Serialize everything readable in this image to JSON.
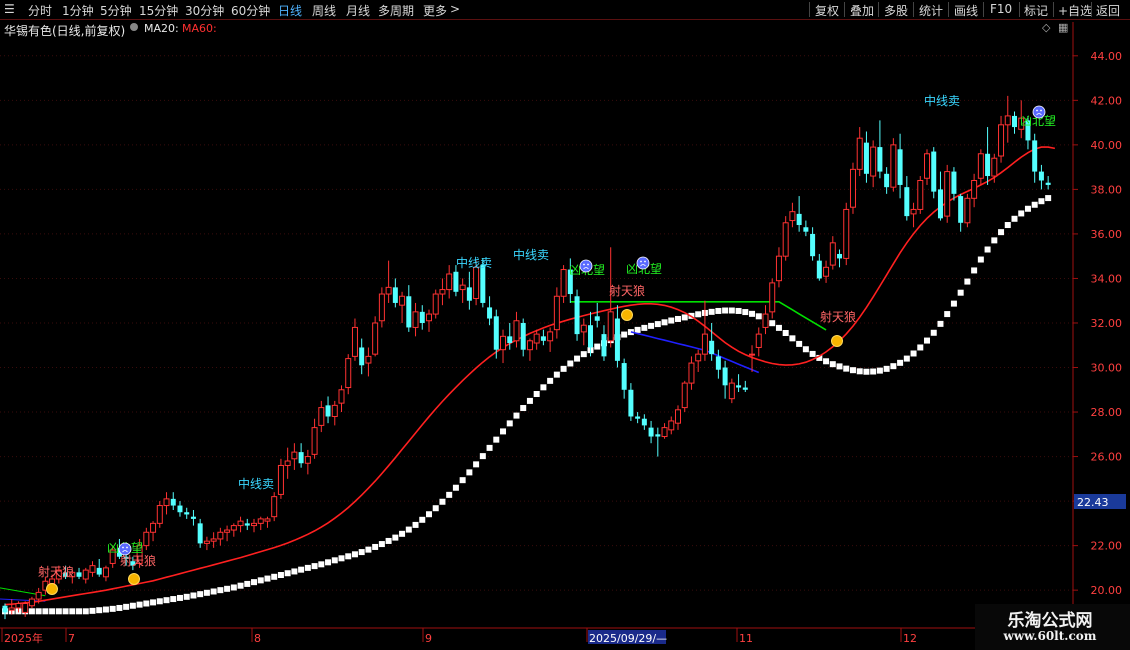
{
  "toolbar": {
    "periods": [
      "分时",
      "1分钟",
      "5分钟",
      "15分钟",
      "30分钟",
      "60分钟",
      "日线",
      "周线",
      "月线",
      "多周期",
      "更多"
    ],
    "active_period": "日线",
    "more_arrow": ">",
    "right_buttons": [
      "复权",
      "叠加",
      "多股",
      "统计",
      "画线",
      "F10",
      "标记",
      "+自选",
      "返回"
    ]
  },
  "info": {
    "title": "华锡有色(日线,前复权)",
    "ma20_label": "MA20:",
    "ma60_label": "MA60:"
  },
  "colors": {
    "up": "#ff3232",
    "down": "#54ffff",
    "ma20": "#ff2020",
    "white_line": "#ffffff",
    "green_line": "#00e000",
    "blue_line": "#2020ff",
    "axis": "#a01010",
    "label_price": "#ff4040",
    "last_price_bg": "#1a3a9a"
  },
  "icons": {
    "frown": "frown-face-icon",
    "coin": "gold-coin-icon",
    "diamond": "diamond-icon",
    "grid": "grid-icon",
    "menu": "menu-icon",
    "dropdown": "dropdown-icon"
  },
  "price_labels": [
    "44.00",
    "42.00",
    "40.00",
    "38.00",
    "36.00",
    "34.00",
    "32.00",
    "30.00",
    "28.00",
    "26.00",
    "24.00",
    "22.00",
    "20.00"
  ],
  "last_price": "22.43",
  "x_labels": [
    "2025年",
    "7",
    "8",
    "9",
    "2025/09/29/—",
    "11",
    "12"
  ],
  "brand": {
    "name": "乐淘公式网",
    "url": "www.60lt.com"
  },
  "chart_data": {
    "type": "candlestick",
    "title": "华锡有色(日线,前复权)",
    "ylim": [
      18.3,
      44.8
    ],
    "y_ticks": [
      20,
      22,
      24,
      26,
      28,
      30,
      32,
      34,
      36,
      38,
      40,
      42,
      44
    ],
    "x_tick_labels": [
      "2025年",
      "7",
      "8",
      "9",
      "2025/09/29/—",
      "11",
      "12"
    ],
    "ohlc": [
      [
        19.3,
        19.4,
        18.7,
        19.0
      ],
      [
        19.1,
        19.6,
        18.9,
        19.2
      ],
      [
        19.2,
        19.5,
        19.0,
        19.4
      ],
      [
        19.0,
        19.5,
        18.8,
        19.4
      ],
      [
        19.3,
        19.7,
        19.2,
        19.6
      ],
      [
        19.6,
        20.1,
        19.4,
        19.9
      ],
      [
        20.0,
        20.6,
        19.8,
        20.4
      ],
      [
        20.3,
        20.7,
        20.1,
        20.5
      ],
      [
        20.5,
        21.1,
        20.3,
        20.9
      ],
      [
        20.8,
        21.1,
        20.5,
        20.6
      ],
      [
        20.6,
        20.9,
        20.3,
        20.8
      ],
      [
        20.8,
        21.0,
        20.5,
        20.6
      ],
      [
        20.5,
        21.0,
        20.3,
        20.9
      ],
      [
        20.8,
        21.3,
        20.6,
        21.1
      ],
      [
        21.0,
        21.4,
        20.6,
        20.7
      ],
      [
        20.6,
        21.1,
        20.4,
        21.0
      ],
      [
        21.2,
        22.0,
        21.0,
        21.8
      ],
      [
        21.9,
        22.3,
        21.4,
        21.5
      ],
      [
        21.5,
        21.9,
        21.1,
        21.4
      ],
      [
        21.3,
        21.5,
        20.9,
        21.1
      ],
      [
        21.2,
        22.3,
        21.0,
        22.0
      ],
      [
        22.0,
        22.8,
        21.8,
        22.6
      ],
      [
        22.6,
        23.1,
        22.2,
        23.0
      ],
      [
        23.0,
        24.0,
        22.8,
        23.8
      ],
      [
        23.8,
        24.4,
        23.4,
        24.1
      ],
      [
        24.1,
        24.4,
        23.6,
        23.8
      ],
      [
        23.8,
        24.0,
        23.3,
        23.5
      ],
      [
        23.5,
        23.7,
        23.2,
        23.4
      ],
      [
        23.3,
        23.6,
        22.9,
        23.2
      ],
      [
        23.0,
        23.2,
        21.9,
        22.1
      ],
      [
        22.1,
        22.4,
        21.8,
        22.2
      ],
      [
        22.2,
        22.6,
        21.9,
        22.3
      ],
      [
        22.3,
        22.8,
        22.0,
        22.6
      ],
      [
        22.6,
        22.9,
        22.2,
        22.7
      ],
      [
        22.7,
        23.0,
        22.4,
        22.9
      ],
      [
        22.9,
        23.3,
        22.6,
        23.1
      ],
      [
        23.0,
        23.2,
        22.7,
        22.9
      ],
      [
        22.9,
        23.2,
        22.6,
        23.0
      ],
      [
        23.0,
        23.3,
        22.7,
        23.2
      ],
      [
        23.1,
        23.3,
        22.8,
        23.2
      ],
      [
        23.3,
        24.4,
        23.1,
        24.2
      ],
      [
        24.3,
        25.9,
        24.1,
        25.6
      ],
      [
        25.6,
        26.4,
        25.0,
        25.8
      ],
      [
        25.9,
        26.6,
        25.4,
        26.2
      ],
      [
        26.2,
        26.6,
        25.5,
        25.7
      ],
      [
        25.7,
        26.3,
        25.2,
        26.0
      ],
      [
        26.1,
        27.7,
        25.9,
        27.3
      ],
      [
        27.4,
        28.5,
        27.1,
        28.2
      ],
      [
        28.3,
        28.7,
        27.5,
        27.8
      ],
      [
        27.8,
        28.5,
        27.4,
        28.3
      ],
      [
        28.4,
        29.2,
        28.0,
        29.0
      ],
      [
        29.1,
        30.6,
        28.8,
        30.4
      ],
      [
        30.5,
        32.2,
        30.3,
        31.8
      ],
      [
        30.9,
        31.3,
        29.7,
        30.1
      ],
      [
        30.2,
        30.9,
        29.6,
        30.5
      ],
      [
        30.6,
        32.3,
        30.5,
        32.0
      ],
      [
        32.1,
        33.6,
        31.8,
        33.3
      ],
      [
        33.3,
        34.8,
        32.9,
        33.6
      ],
      [
        33.6,
        34.0,
        32.7,
        32.9
      ],
      [
        32.8,
        33.4,
        32.0,
        33.2
      ],
      [
        33.2,
        33.7,
        31.6,
        31.8
      ],
      [
        31.8,
        32.9,
        31.4,
        32.5
      ],
      [
        32.5,
        32.8,
        31.7,
        32.0
      ],
      [
        32.1,
        32.6,
        31.6,
        32.4
      ],
      [
        32.4,
        33.5,
        32.2,
        33.3
      ],
      [
        33.3,
        34.0,
        32.8,
        33.5
      ],
      [
        33.5,
        34.6,
        33.1,
        34.2
      ],
      [
        34.3,
        34.6,
        33.2,
        33.4
      ],
      [
        33.5,
        34.0,
        32.9,
        33.7
      ],
      [
        33.6,
        34.3,
        32.6,
        33.0
      ],
      [
        33.1,
        34.8,
        32.8,
        34.5
      ],
      [
        34.6,
        34.9,
        32.7,
        32.9
      ],
      [
        32.7,
        33.2,
        31.9,
        32.2
      ],
      [
        32.3,
        32.6,
        30.4,
        30.8
      ],
      [
        30.8,
        31.7,
        30.2,
        31.4
      ],
      [
        31.4,
        32.0,
        30.8,
        31.1
      ],
      [
        31.2,
        32.5,
        30.9,
        32.1
      ],
      [
        32.0,
        32.2,
        30.5,
        30.8
      ],
      [
        30.8,
        31.3,
        30.3,
        31.2
      ],
      [
        31.1,
        31.7,
        30.8,
        31.5
      ],
      [
        31.4,
        31.7,
        31.0,
        31.2
      ],
      [
        31.2,
        31.8,
        30.7,
        31.6
      ],
      [
        31.7,
        33.6,
        31.3,
        33.2
      ],
      [
        33.2,
        34.6,
        32.9,
        34.4
      ],
      [
        34.4,
        34.9,
        32.9,
        33.3
      ],
      [
        33.2,
        33.5,
        31.2,
        31.5
      ],
      [
        31.6,
        32.2,
        31.0,
        31.9
      ],
      [
        31.9,
        32.5,
        30.5,
        30.9
      ],
      [
        32.3,
        32.9,
        31.8,
        32.1
      ],
      [
        31.5,
        31.9,
        30.3,
        30.5
      ],
      [
        31.2,
        35.4,
        30.9,
        32.5
      ],
      [
        32.2,
        32.8,
        30.0,
        30.3
      ],
      [
        30.2,
        30.4,
        28.6,
        29.0
      ],
      [
        29.0,
        29.3,
        27.6,
        27.8
      ],
      [
        27.8,
        28.0,
        27.5,
        27.7
      ],
      [
        27.7,
        27.9,
        27.2,
        27.4
      ],
      [
        27.3,
        27.6,
        26.6,
        26.9
      ],
      [
        27.0,
        27.3,
        26.0,
        26.9
      ],
      [
        26.9,
        27.5,
        26.8,
        27.3
      ],
      [
        27.2,
        27.8,
        27.0,
        27.6
      ],
      [
        27.5,
        28.3,
        27.2,
        28.1
      ],
      [
        28.2,
        29.4,
        28.0,
        29.3
      ],
      [
        29.3,
        30.5,
        29.0,
        30.2
      ],
      [
        30.3,
        30.8,
        29.8,
        30.6
      ],
      [
        30.6,
        33.0,
        30.3,
        31.5
      ],
      [
        31.2,
        32.0,
        30.3,
        30.6
      ],
      [
        30.5,
        30.8,
        29.5,
        29.9
      ],
      [
        30.0,
        30.3,
        28.6,
        29.2
      ],
      [
        28.6,
        29.5,
        28.4,
        29.3
      ],
      [
        29.2,
        29.7,
        28.9,
        29.1
      ],
      [
        29.1,
        29.4,
        28.9,
        29.0
      ],
      [
        30.6,
        31.0,
        29.8,
        30.6
      ],
      [
        30.9,
        31.8,
        30.5,
        31.5
      ],
      [
        31.8,
        32.8,
        31.5,
        32.4
      ],
      [
        32.5,
        34.0,
        32.2,
        33.8
      ],
      [
        33.9,
        35.4,
        33.6,
        35.0
      ],
      [
        35.0,
        36.8,
        34.8,
        36.5
      ],
      [
        36.6,
        37.4,
        36.3,
        37.0
      ],
      [
        36.9,
        37.7,
        36.1,
        36.4
      ],
      [
        36.3,
        36.6,
        35.9,
        36.1
      ],
      [
        36.0,
        36.3,
        34.8,
        35.0
      ],
      [
        34.8,
        35.1,
        33.9,
        34.0
      ],
      [
        34.1,
        34.8,
        33.8,
        34.5
      ],
      [
        34.6,
        35.9,
        34.4,
        35.6
      ],
      [
        35.1,
        35.3,
        34.5,
        34.9
      ],
      [
        34.9,
        37.4,
        34.6,
        37.1
      ],
      [
        37.2,
        39.2,
        36.9,
        38.9
      ],
      [
        38.9,
        40.8,
        38.6,
        40.3
      ],
      [
        40.1,
        40.6,
        38.3,
        38.7
      ],
      [
        38.6,
        40.2,
        38.1,
        39.9
      ],
      [
        39.9,
        41.1,
        38.5,
        38.8
      ],
      [
        38.7,
        39.0,
        37.8,
        38.1
      ],
      [
        38.1,
        40.3,
        37.9,
        40.0
      ],
      [
        39.8,
        40.5,
        37.6,
        38.2
      ],
      [
        38.1,
        38.6,
        36.6,
        36.8
      ],
      [
        36.9,
        37.4,
        36.3,
        37.1
      ],
      [
        37.1,
        38.6,
        36.9,
        38.4
      ],
      [
        38.5,
        39.8,
        38.2,
        39.6
      ],
      [
        39.7,
        39.9,
        37.6,
        37.9
      ],
      [
        38.0,
        38.8,
        36.6,
        36.7
      ],
      [
        36.8,
        39.1,
        36.5,
        38.8
      ],
      [
        38.8,
        39.0,
        37.5,
        37.8
      ],
      [
        37.7,
        37.8,
        36.1,
        36.5
      ],
      [
        36.5,
        37.8,
        36.3,
        37.6
      ],
      [
        37.6,
        38.7,
        37.2,
        38.4
      ],
      [
        38.5,
        39.8,
        38.2,
        39.6
      ],
      [
        39.6,
        40.8,
        38.2,
        38.6
      ],
      [
        38.6,
        39.6,
        38.3,
        39.4
      ],
      [
        39.5,
        41.3,
        39.2,
        40.9
      ],
      [
        40.9,
        42.2,
        40.1,
        41.3
      ],
      [
        41.3,
        41.5,
        40.5,
        40.8
      ],
      [
        40.7,
        42.0,
        40.3,
        41.2
      ],
      [
        41.1,
        41.3,
        39.8,
        40.2
      ],
      [
        40.2,
        40.5,
        38.3,
        38.8
      ],
      [
        38.8,
        39.1,
        38.0,
        38.4
      ],
      [
        38.3,
        38.6,
        38.0,
        38.2
      ]
    ],
    "ma20": [
      19.35,
      19.37,
      19.4,
      19.43,
      19.46,
      19.5,
      19.55,
      19.6,
      19.65,
      19.7,
      19.75,
      19.8,
      19.85,
      19.9,
      19.95,
      20.0,
      20.06,
      20.12,
      20.18,
      20.24,
      20.3,
      20.36,
      20.42,
      20.5,
      20.58,
      20.66,
      20.74,
      20.82,
      20.9,
      20.98,
      21.06,
      21.14,
      21.22,
      21.3,
      21.38,
      21.46,
      21.55,
      21.64,
      21.73,
      21.82,
      21.91,
      22.01,
      22.12,
      22.24,
      22.37,
      22.51,
      22.66,
      22.83,
      23.02,
      23.23,
      23.46,
      23.71,
      23.98,
      24.27,
      24.58,
      24.9,
      25.24,
      25.59,
      25.95,
      26.32,
      26.69,
      27.06,
      27.43,
      27.79,
      28.14,
      28.48,
      28.8,
      29.11,
      29.41,
      29.7,
      29.98,
      30.24,
      30.48,
      30.7,
      30.9,
      31.08,
      31.24,
      31.39,
      31.53,
      31.66,
      31.78,
      31.89,
      31.99,
      32.08,
      32.17,
      32.25,
      32.33,
      32.41,
      32.48,
      32.55,
      32.62,
      32.69,
      32.75,
      32.8,
      32.84,
      32.86,
      32.86,
      32.84,
      32.79,
      32.71,
      32.6,
      32.46,
      32.29,
      32.08,
      31.85,
      31.61,
      31.36,
      31.12,
      30.91,
      30.73,
      30.58,
      30.45,
      30.35,
      30.25,
      30.18,
      30.13,
      30.11,
      30.12,
      30.16,
      30.24,
      30.36,
      30.51,
      30.7,
      30.93,
      31.2,
      31.51,
      31.86,
      32.26,
      32.7,
      33.17,
      33.66,
      34.16,
      34.66,
      35.15,
      35.6,
      36.01,
      36.38,
      36.7,
      36.98,
      37.22,
      37.43,
      37.61,
      37.77,
      37.91,
      38.05,
      38.2,
      38.36,
      38.54,
      38.75,
      38.98,
      39.22,
      39.45,
      39.65,
      39.81,
      39.9,
      39.9,
      39.84
    ],
    "annotations": [
      {
        "text": "中线卖",
        "color": "#3ad7ff"
      },
      {
        "text": "中线卖",
        "color": "#3ad7ff"
      },
      {
        "text": "中线卖",
        "color": "#3ad7ff"
      },
      {
        "text": "中线卖",
        "color": "#3ad7ff"
      },
      {
        "text": "凶北望",
        "color": "#22ee22"
      },
      {
        "text": "凶北望",
        "color": "#22ee22"
      },
      {
        "text": "凶北望",
        "color": "#22ee22"
      },
      {
        "text": "凶北望",
        "color": "#22ee22"
      },
      {
        "text": "射天狼",
        "color": "#ff6666"
      },
      {
        "text": "射天狼",
        "color": "#ff6666"
      },
      {
        "text": "射天狼",
        "color": "#ff6666"
      },
      {
        "text": "射天狼",
        "color": "#ff6666"
      }
    ]
  }
}
